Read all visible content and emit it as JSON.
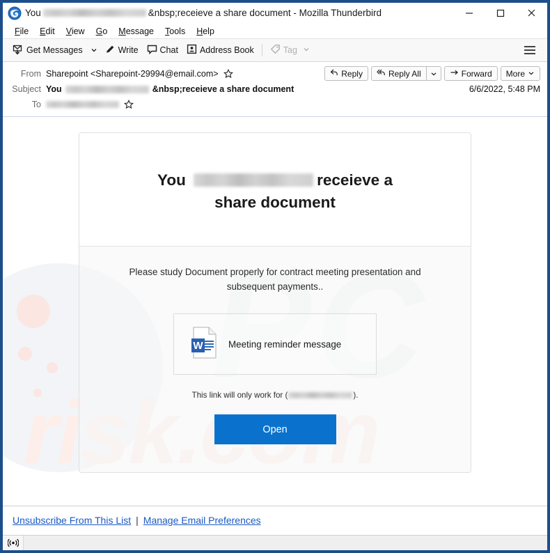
{
  "window": {
    "title_prefix": "You",
    "title_redacted": "(redacted email address)",
    "title_suffix": "&nbsp;receieve a share document - Mozilla Thunderbird",
    "logo_icon": "thunderbird-logo-icon",
    "controls": {
      "minimize": "minimize-icon",
      "maximize": "maximize-icon",
      "close": "close-icon"
    },
    "border_color": "#1c4e8a"
  },
  "menubar": {
    "items": [
      {
        "label": "File",
        "access": "F"
      },
      {
        "label": "Edit",
        "access": "E"
      },
      {
        "label": "View",
        "access": "V"
      },
      {
        "label": "Go",
        "access": "G"
      },
      {
        "label": "Message",
        "access": "M"
      },
      {
        "label": "Tools",
        "access": "T"
      },
      {
        "label": "Help",
        "access": "H"
      }
    ]
  },
  "toolbar": {
    "get_messages": "Get Messages",
    "get_messages_icon": "get-messages-icon",
    "get_messages_caret": "chevron-down-icon",
    "write": "Write",
    "write_icon": "pencil-icon",
    "chat": "Chat",
    "chat_icon": "chat-bubble-icon",
    "address_book": "Address Book",
    "address_book_icon": "address-book-icon",
    "tag": "Tag",
    "tag_icon": "tag-icon",
    "tag_caret": "chevron-down-icon",
    "tag_disabled": true,
    "menu_icon": "hamburger-menu-icon"
  },
  "message": {
    "from_label": "From",
    "from_value": "Sharepoint <Sharepoint-29994@email.com>",
    "from_star_icon": "star-outline-icon",
    "subject_label": "Subject",
    "subject_prefix": "You",
    "subject_redacted": "(redacted email address)",
    "subject_suffix": "&nbsp;receieve a share document",
    "to_label": "To",
    "to_redacted": "(redacted email address)",
    "to_star_icon": "star-outline-icon",
    "date": "6/6/2022, 5:48 PM",
    "actions": {
      "reply": "Reply",
      "reply_icon": "reply-arrow-icon",
      "reply_all": "Reply All",
      "reply_all_icon": "reply-all-arrow-icon",
      "reply_all_caret": "chevron-down-icon",
      "forward": "Forward",
      "forward_icon": "forward-arrow-icon",
      "more": "More",
      "more_caret": "chevron-down-icon"
    }
  },
  "email_body": {
    "heading_prefix": "You",
    "heading_redacted": "(redacted email address)",
    "heading_suffix": "receieve a",
    "heading_line2": "share document",
    "paragraph": "Please study Document properly for contract meeting presentation and subsequent payments..",
    "document": {
      "icon": "word-document-icon",
      "label": "Meeting reminder message"
    },
    "link_note_prefix": "This link will only work for (",
    "link_note_redacted": "(redacted email address)",
    "link_note_suffix": ").",
    "open_button": "Open",
    "open_button_color": "#0a72cd",
    "watermarks": {
      "brand": "PC",
      "site": "risk.com"
    }
  },
  "footer": {
    "unsubscribe": "Unsubscribe From This List",
    "separator": "|",
    "manage": "Manage Email Preferences",
    "link_color": "#1959c4"
  },
  "statusbar": {
    "icon": "broadcast-online-icon"
  }
}
